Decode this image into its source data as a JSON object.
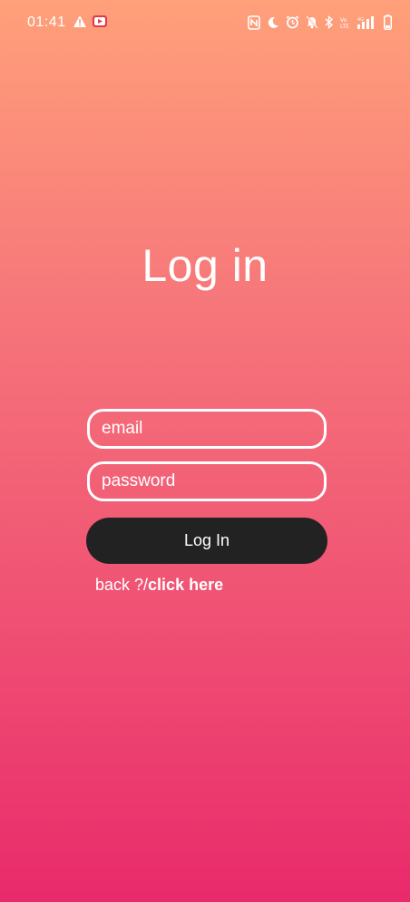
{
  "status_bar": {
    "time": "01:41",
    "left_icons": [
      "warning-icon",
      "youtube-icon"
    ],
    "right_icons": [
      "nfc-icon",
      "moon-icon",
      "alarm-icon",
      "notifications-off-icon",
      "bluetooth-icon",
      "volte-icon",
      "signal-icon",
      "battery-icon"
    ],
    "volte_label": "VoLTE"
  },
  "title": "Log in",
  "form": {
    "email_placeholder": "email",
    "password_placeholder": "password",
    "login_label": "Log In"
  },
  "back": {
    "prefix": "back ?/",
    "link": "click here"
  },
  "colors": {
    "gradient_top": "#ffa07a",
    "gradient_bottom": "#e92a6b",
    "button_bg": "#222222",
    "text": "#ffffff"
  }
}
